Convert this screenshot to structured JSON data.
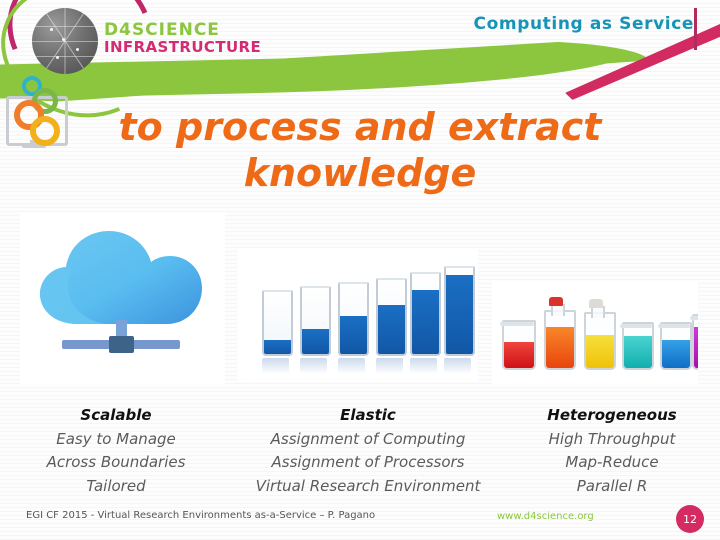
{
  "header": {
    "title": "Computing as Service"
  },
  "logo": {
    "line1": "D4SCIENCE",
    "line2": "INFRASTRUCTURE",
    "green": "#8cc63e",
    "pink": "#d42b72"
  },
  "title": {
    "line1": "to process and extract",
    "line2": "knowledge",
    "color": "#ef6a17"
  },
  "images": {
    "cloud": {
      "caption_ref": "Scalable",
      "alt": "blue cloud connected to a network bar"
    },
    "glasses": {
      "caption_ref": "Elastic",
      "alt": "six drinking glasses filled with increasing levels of blue liquid",
      "levels": [
        22,
        38,
        54,
        66,
        80,
        92
      ]
    },
    "flasks": {
      "caption_ref": "Heterogeneous",
      "alt": "six laboratory vessels with different coloured liquids",
      "colors": [
        "#e8202a",
        "#f1590f",
        "#f2d21a",
        "#17bcbb",
        "#1c86d6",
        "#bb22c2"
      ]
    }
  },
  "columns": [
    {
      "heading": "Scalable",
      "lines": [
        "Easy to Manage",
        "Across Boundaries",
        "Tailored"
      ]
    },
    {
      "heading": "Elastic",
      "lines": [
        "Assignment of Computing",
        "Assignment of Processors",
        "Virtual Research Environment"
      ]
    },
    {
      "heading": "Heterogeneous",
      "lines": [
        "High Throughput",
        "Map-Reduce",
        "Parallel R"
      ]
    }
  ],
  "footer": {
    "left": "EGI CF 2015 - Virtual Research Environments as-a-Service – P. Pagano",
    "url": "www.d4science.org",
    "page": "12",
    "url_color": "#8cc63e",
    "badge_color": "#d42b62"
  }
}
